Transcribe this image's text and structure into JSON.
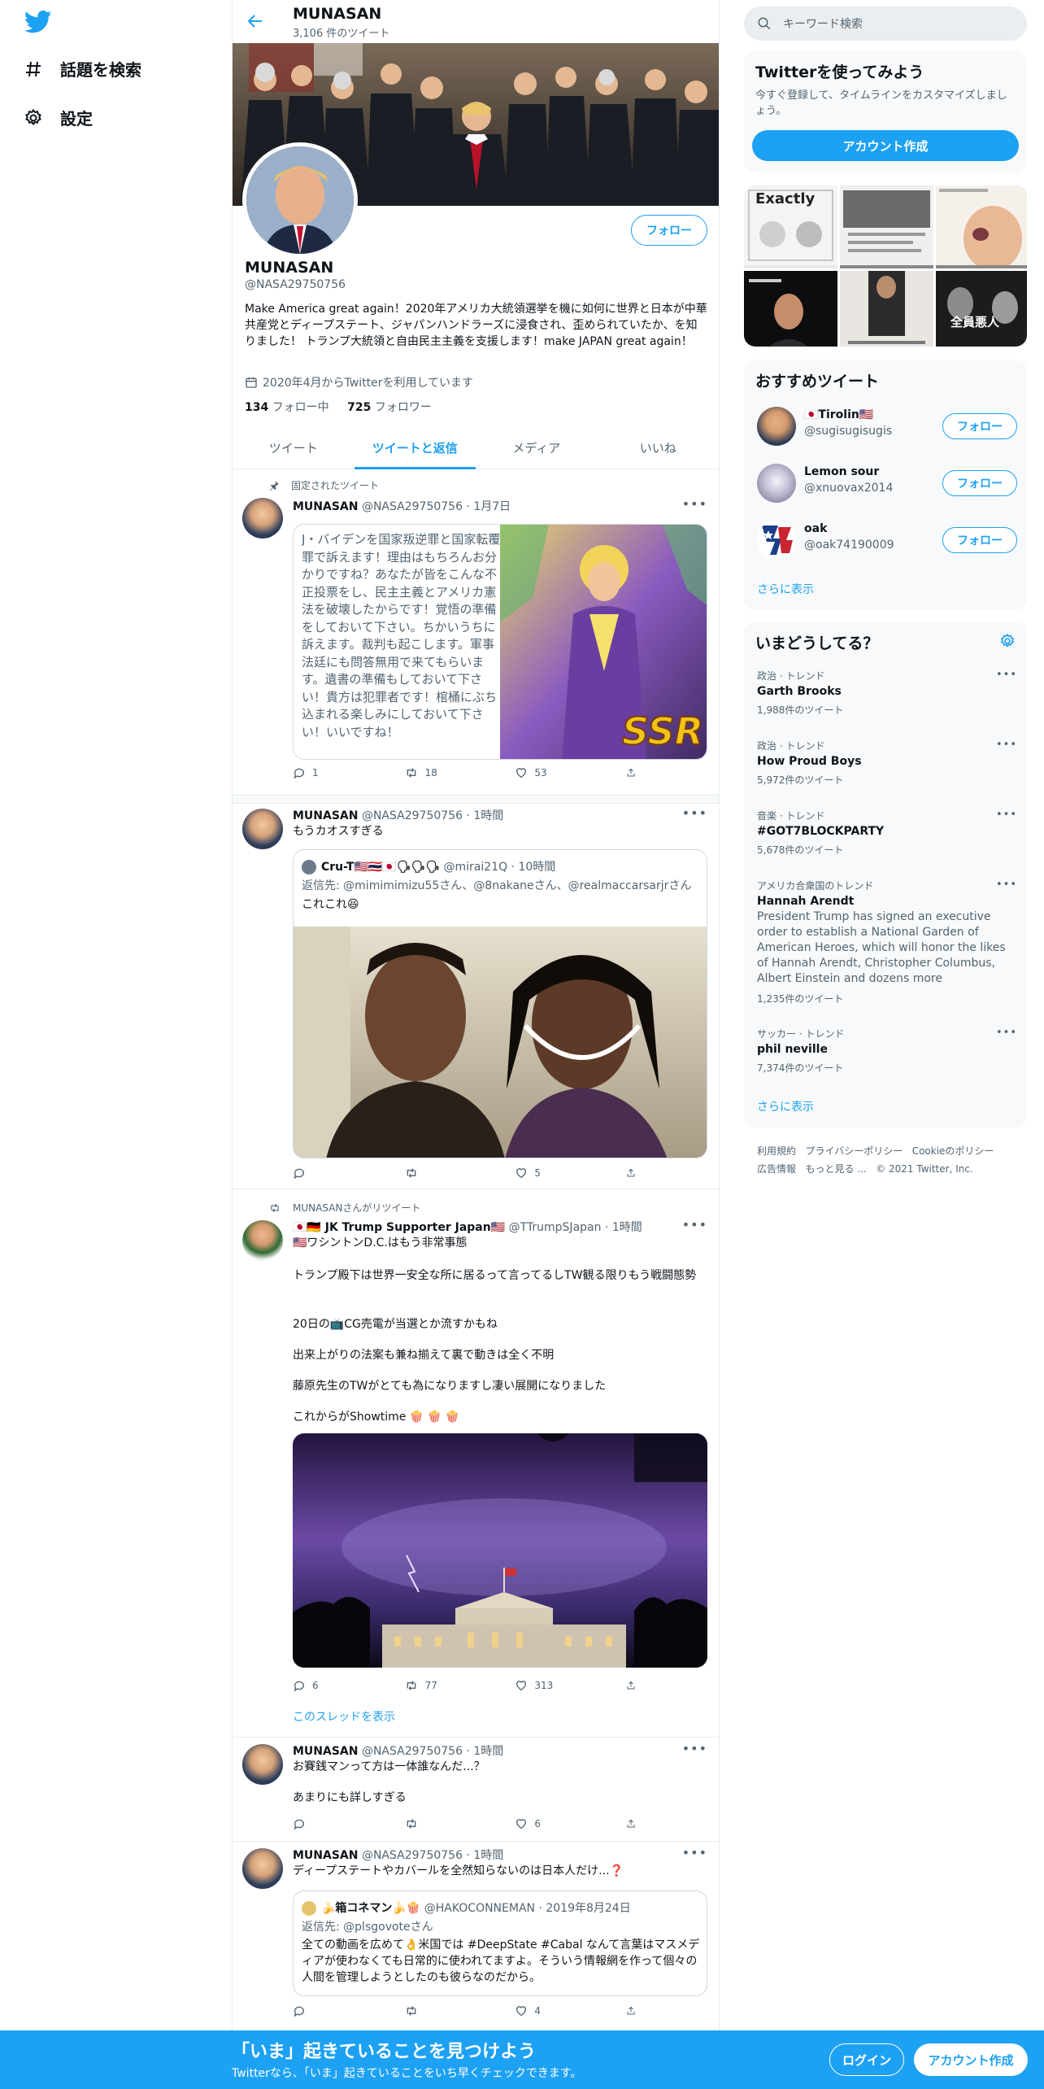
{
  "nav": {
    "explore_label": "話題を検索",
    "settings_label": "設定"
  },
  "profile_header": {
    "name": "MUNASAN",
    "tweet_count": "3,106 件のツイート"
  },
  "profile": {
    "name": "MUNASAN",
    "handle": "@NASA29750756",
    "follow_label": "フォロー",
    "bio": "Make America great again！2020年アメリカ大統領選挙を機に如何に世界と日本が中華共産党とディープステート、ジャパンハンドラーズに浸食され、歪められていたか、を知りました！ トランプ大統領と自由民主主義を支援します！make JAPAN great again！",
    "joined": "2020年4月からTwitterを利用しています",
    "following_count": "134",
    "following_label": "フォロー中",
    "followers_count": "725",
    "followers_label": "フォロワー"
  },
  "tabs": [
    "ツイート",
    "ツイートと返信",
    "メディア",
    "いいね"
  ],
  "tweets": [
    {
      "pinned_label": "固定されたツイート",
      "name": "MUNASAN",
      "handle": "@NASA29750756",
      "time": "· 1月7日",
      "text": "J・バイデンを国家叛逆罪と国家転覆罪で訴えます！理由はもちろんお分かりですね？あなたが皆をこんな不正投票をし、民主主義とアメリカ憲法を破壊したからです！覚悟の準備をしておいて下さい。ちかいうちに訴えます。裁判も起こします。軍事法廷にも問答無用で来てもらいます。遺書の準備もしておいて下さい！貴方は犯罪者です！棺桶にぶち込まれる楽しみにしておいて下さい！いいですね！",
      "replies": "1",
      "retweets": "18",
      "likes": "53"
    },
    {
      "name": "MUNASAN",
      "handle": "@NASA29750756",
      "time": "· 1時間",
      "text": "もうカオスすぎる",
      "quote_name": "Cru-T🇺🇸🇹🇭🇯🇵🗣🗣🗣",
      "quote_handle": "@mirai21Q",
      "quote_time": "· 10時間",
      "quote_reply": "返信先: @mimimimizu55さん、@8nakaneさん、@realmaccarsarjrさん",
      "quote_text": "これこれ😆",
      "likes": "5"
    },
    {
      "retweet_label": "MUNASANさんがリツイート",
      "name": "🇯🇵🇩🇪 JK Trump Supporter Japan🇺🇸",
      "handle": "@TTrumpSJapan",
      "time": "· 1時間",
      "p1": "🇺🇸ワシントンD.C.はもう非常事態",
      "p2": "トランプ殿下は世界一安全な所に居るって言ってるしTW観る限りもう戦闘態勢",
      "p3": "20日の📺CG売電が当選とか流すかもね",
      "p4": "出来上がりの法案も兼ね揃えて裏で動きは全く不明",
      "p5": "藤原先生のTWがとても為になりますし凄い展開になりました",
      "p6": "これからがShowtime 🍿 🍿 🍿",
      "replies": "6",
      "retweets": "77",
      "likes": "313",
      "thread_link": "このスレッドを表示"
    },
    {
      "name": "MUNASAN",
      "handle": "@NASA29750756",
      "time": "· 1時間",
      "p1": "お賽銭マンって方は一体誰なんだ...？",
      "p2": "あまりにも詳しすぎる",
      "likes": "6"
    },
    {
      "name": "MUNASAN",
      "handle": "@NASA29750756",
      "time": "· 1時間",
      "text": "ディープステートやカバールを全然知らないのは日本人だけ...❓",
      "quote_name": "🍌箱コネマン🍌🍿",
      "quote_handle": "@HAKOCONNEMAN",
      "quote_time": "· 2019年8月24日",
      "quote_reply": "返信先: @plsgovoteさん",
      "quote_text": "全ての動画を広めて👌米国では #DeepState #Cabal なんて言葉はマスメディアが使わなくても日常的に使われてますよ。そういう情報網を作って個々の人間を管理しようとしたのも彼らなのだから。",
      "likes": "4"
    }
  ],
  "sidebar": {
    "search_placeholder": "キーワード検索",
    "signup": {
      "title": "Twitterを使ってみよう",
      "desc": "今すぐ登録して、タイムラインをカスタマイズしましょう。",
      "button": "アカウント作成"
    },
    "media_tiles": {
      "tile1": "Exactly",
      "tile6": "全員悪人"
    },
    "who_to_follow": {
      "title": "おすすめツイート",
      "users": [
        {
          "name": "🇯🇵Tirolin🇺🇸",
          "handle": "@sugisugisugis",
          "button": "フォロー"
        },
        {
          "name": "Lemon sour",
          "handle": "@xnuovax2014",
          "button": "フォロー"
        },
        {
          "name": "oak",
          "handle": "@oak74190009",
          "button": "フォロー"
        }
      ],
      "more": "さらに表示"
    },
    "trends": {
      "title": "いまどうしてる？",
      "items": [
        {
          "meta": "政治 · トレンド",
          "title": "Garth Brooks",
          "count": "1,988件のツイート"
        },
        {
          "meta": "政治 · トレンド",
          "title": "How Proud Boys",
          "count": "5,972件のツイート"
        },
        {
          "meta": "音楽 · トレンド",
          "title": "#GOT7BLOCKPARTY",
          "count": "5,678件のツイート"
        },
        {
          "meta": "アメリカ合衆国のトレンド",
          "title": "Hannah Arendt",
          "desc": "President Trump has signed an executive order to establish a National Garden of American Heroes, which will honor the likes of Hannah Arendt, Christopher Columbus, Albert Einstein and dozens more",
          "count": "1,235件のツイート"
        },
        {
          "meta": "サッカー · トレンド",
          "title": "phil neville",
          "count": "7,374件のツイート"
        }
      ],
      "more": "さらに表示"
    },
    "footer": {
      "terms": "利用規約",
      "privacy": "プライバシーポリシー",
      "cookie": "Cookieのポリシー",
      "ads": "広告情報",
      "more": "もっと見る ...",
      "copyright": "© 2021 Twitter, Inc."
    }
  },
  "bottom_bar": {
    "title": "「いま」起きていることを見つけよう",
    "subtitle": "Twitterなら、「いま」起きていることをいち早くチェックできます。",
    "login": "ログイン",
    "signup": "アカウント作成"
  },
  "colors": {
    "accent": "#1da1f2",
    "text": "#0f1419",
    "muted": "#536471",
    "border": "#e6ecf0"
  }
}
